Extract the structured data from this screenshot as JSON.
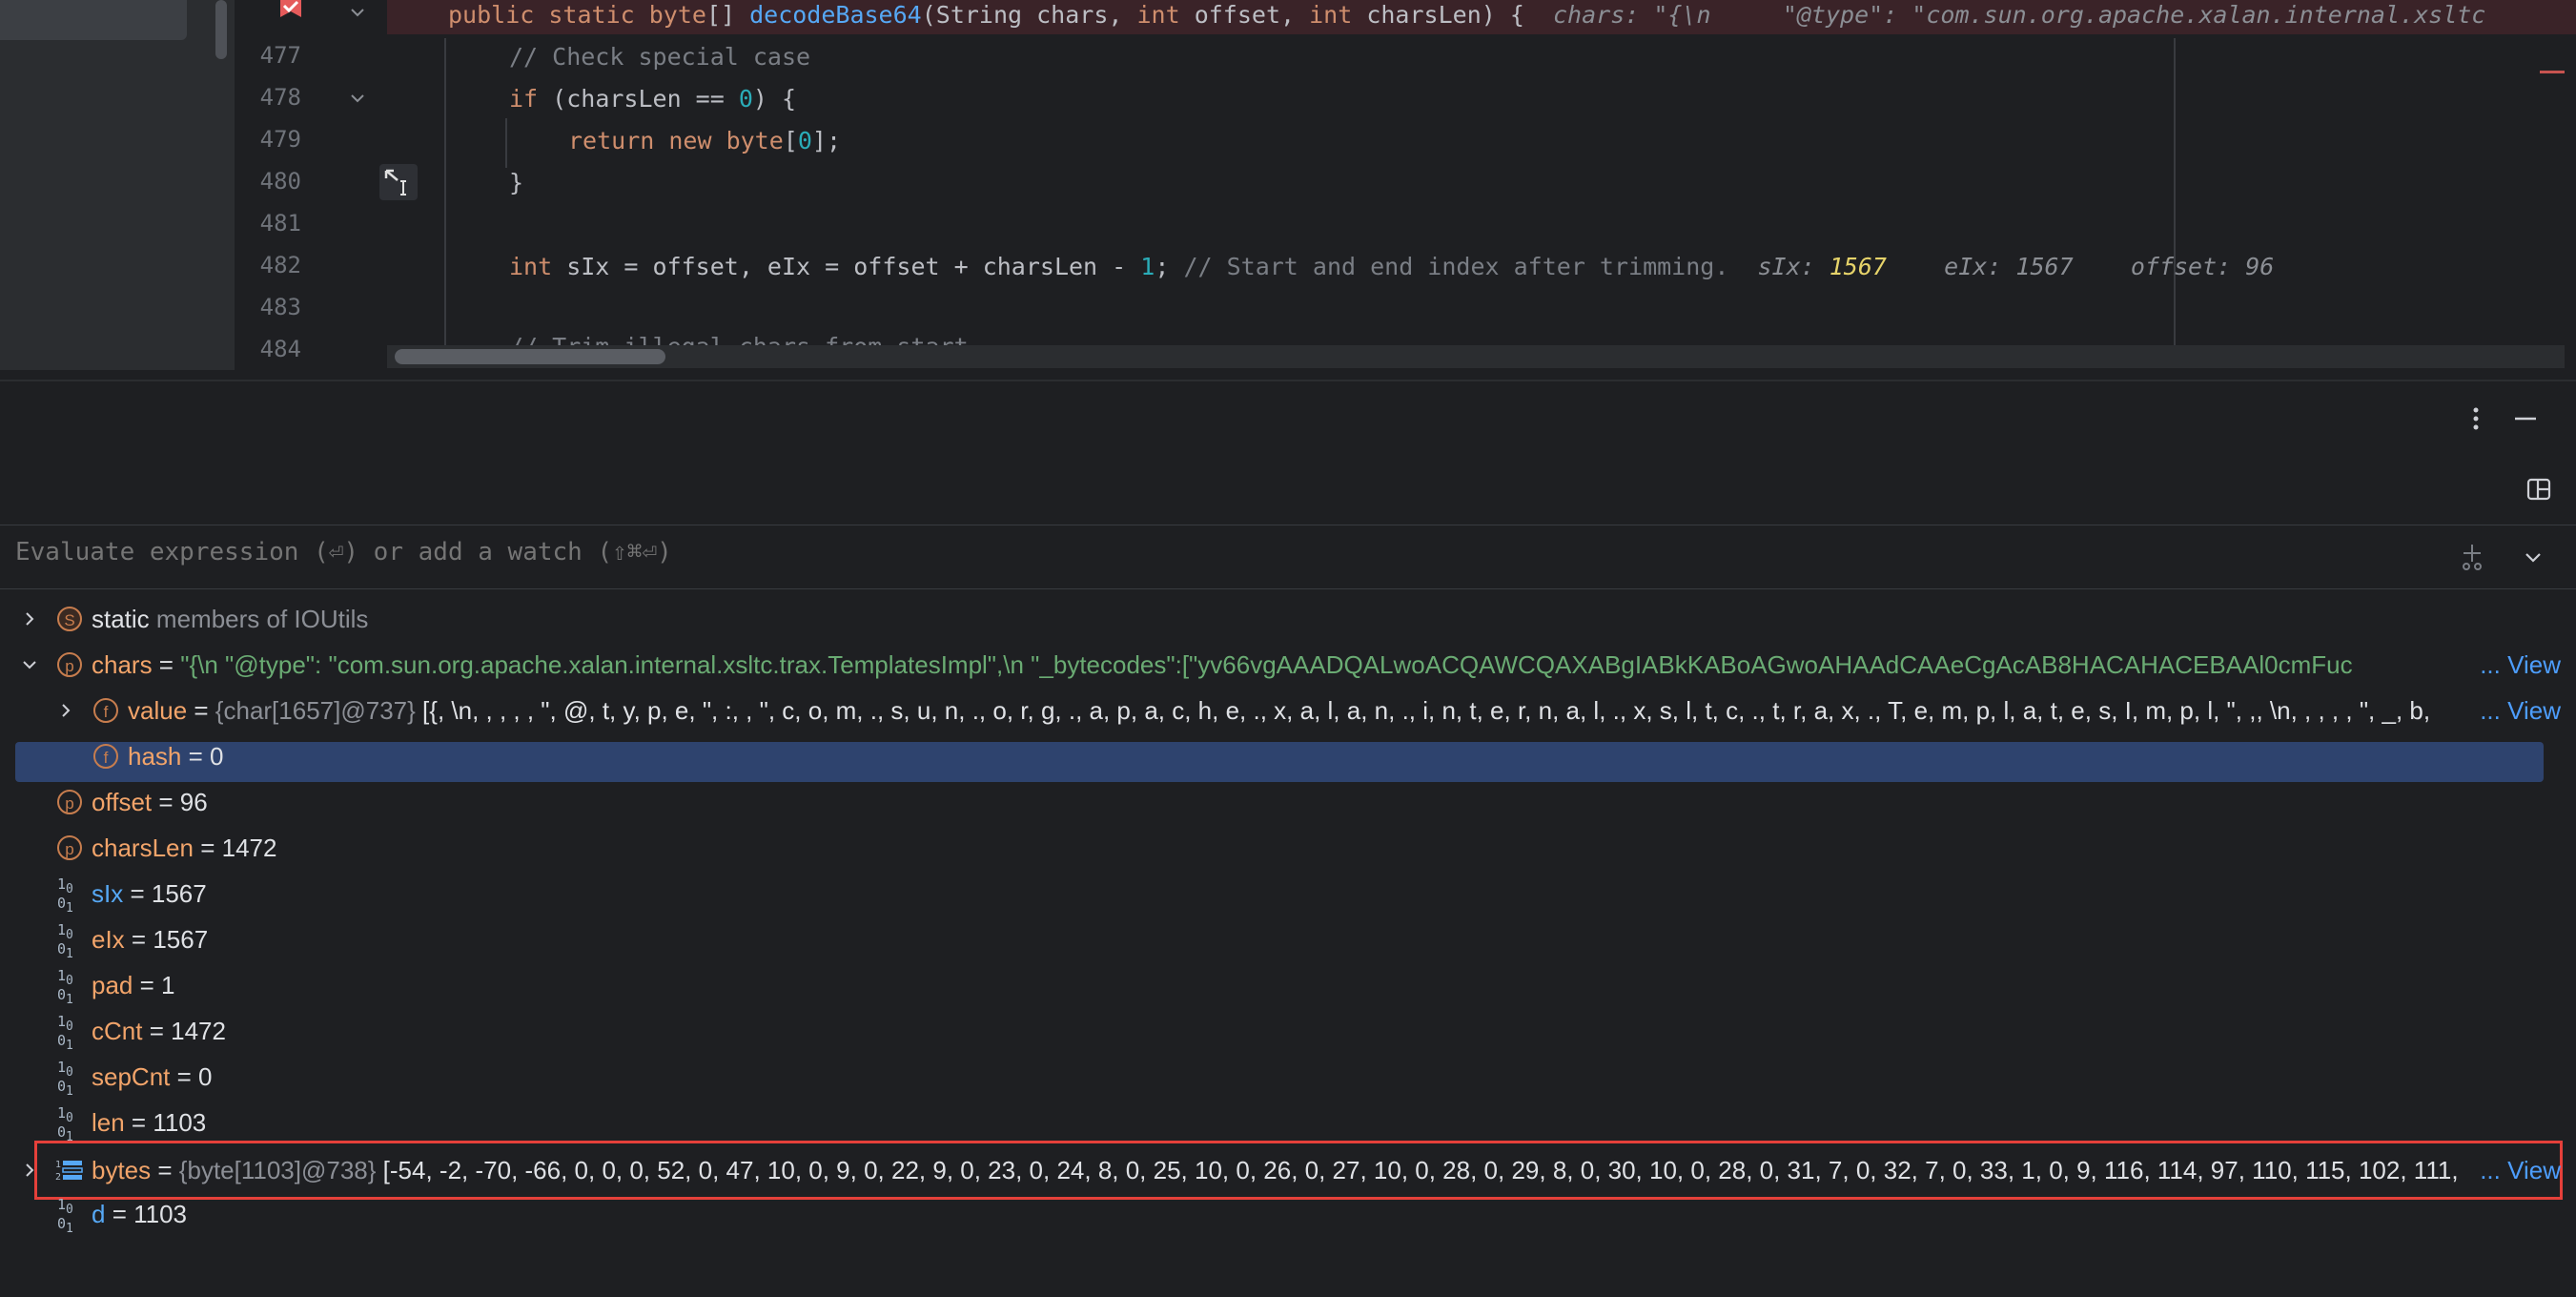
{
  "editor": {
    "line_numbers": [
      "477",
      "478",
      "479",
      "480",
      "481",
      "482",
      "483",
      "484"
    ],
    "line476": {
      "kw1": "public static ",
      "kw2": "byte",
      "rest1": "[] ",
      "fn": "decodeBase64",
      "rest2": "(String chars, ",
      "kw3": "int",
      "rest3": " offset, ",
      "kw4": "int",
      "rest4": " charsLen) {",
      "hint": "  chars: \"{\\n     \"@type\": \"com.sun.org.apache.xalan.internal.xsltc"
    },
    "line477": "// Check special case",
    "line478": {
      "kw": "if",
      "a": " (charsLen == ",
      "num": "0",
      "b": ") {"
    },
    "line479": {
      "kw1": "return new ",
      "kw2": "byte",
      "a": "[",
      "num": "0",
      "b": "];"
    },
    "line480": "}",
    "line482": {
      "kw": "int",
      "a": " sIx = offset, eIx = offset + charsLen - ",
      "num": "1",
      "b": "; ",
      "comment": "// Start and end index after trimming.",
      "hint1_label": "  sIx: ",
      "hint1_value": "1567",
      "hint2": "    eIx: 1567    offset: 96"
    },
    "line484": "// Trim illegal chars from start"
  },
  "debugger": {
    "eval_placeholder": "Evaluate expression (⏎) or add a watch (⇧⌘⏎)",
    "view_label": "View",
    "ellipsis": "...",
    "variables": [
      {
        "badge": "S",
        "name": "static",
        "rest": " members of IOUtils"
      },
      {
        "badge": "p",
        "name": "chars",
        "eq": " = ",
        "value": "\"{\\n     \"@type\": \"com.sun.org.apache.xalan.internal.xsltc.trax.TemplatesImpl\",\\n     \"_bytecodes\":[\"yv66vgAAADQALwoACQAWCQAXABgIABkKABoAGwoAHAAdCAAeCgAcAB8HACAHACEBAAl0cmFuc"
      },
      {
        "badge": "f",
        "name": "value",
        "eq": " = ",
        "type": "{char[1657]@737} ",
        "value": "[{, \\n,  ,  ,  ,  , \", @, t, y, p, e, \", :,  , \", c, o, m, ., s, u, n, ., o, r, g, ., a, p, a, c, h, e, ., x, a, l, a, n, ., i, n, t, e, r, n, a, l, ., x, s, l, t, c, ., t, r, a, x, ., T, e, m, p, l, a, t, e, s, I, m, p, l, \", ,, \\n,  ,  ,  ,  , \", _, b,"
      },
      {
        "badge": "f",
        "name": "hash",
        "eq": " = ",
        "value": "0"
      },
      {
        "badge": "p",
        "name": "offset",
        "eq": " = ",
        "value": "96"
      },
      {
        "badge": "p",
        "name": "charsLen",
        "eq": " = ",
        "value": "1472"
      },
      {
        "badge": "01",
        "name": "sIx",
        "eq": " = ",
        "value": "1567"
      },
      {
        "badge": "01",
        "name": "eIx",
        "eq": " = ",
        "value": "1567"
      },
      {
        "badge": "01",
        "name": "pad",
        "eq": " = ",
        "value": "1"
      },
      {
        "badge": "01",
        "name": "cCnt",
        "eq": " = ",
        "value": "1472"
      },
      {
        "badge": "01",
        "name": "sepCnt",
        "eq": " = ",
        "value": "0"
      },
      {
        "badge": "01",
        "name": "len",
        "eq": " = ",
        "value": "1103"
      },
      {
        "badge": "arr",
        "name": "bytes",
        "eq": " = ",
        "type": "{byte[1103]@738} ",
        "value": "[-54, -2, -70, -66, 0, 0, 0, 52, 0, 47, 10, 0, 9, 0, 22, 9, 0, 23, 0, 24, 8, 0, 25, 10, 0, 26, 0, 27, 10, 0, 28, 0, 29, 8, 0, 30, 10, 0, 28, 0, 31, 7, 0, 32, 7, 0, 33, 1, 0, 9, 116, 114, 97, 110, 115, 102, 111,"
      },
      {
        "badge": "01",
        "name": "d",
        "eq": " = ",
        "value": "1103"
      }
    ]
  }
}
